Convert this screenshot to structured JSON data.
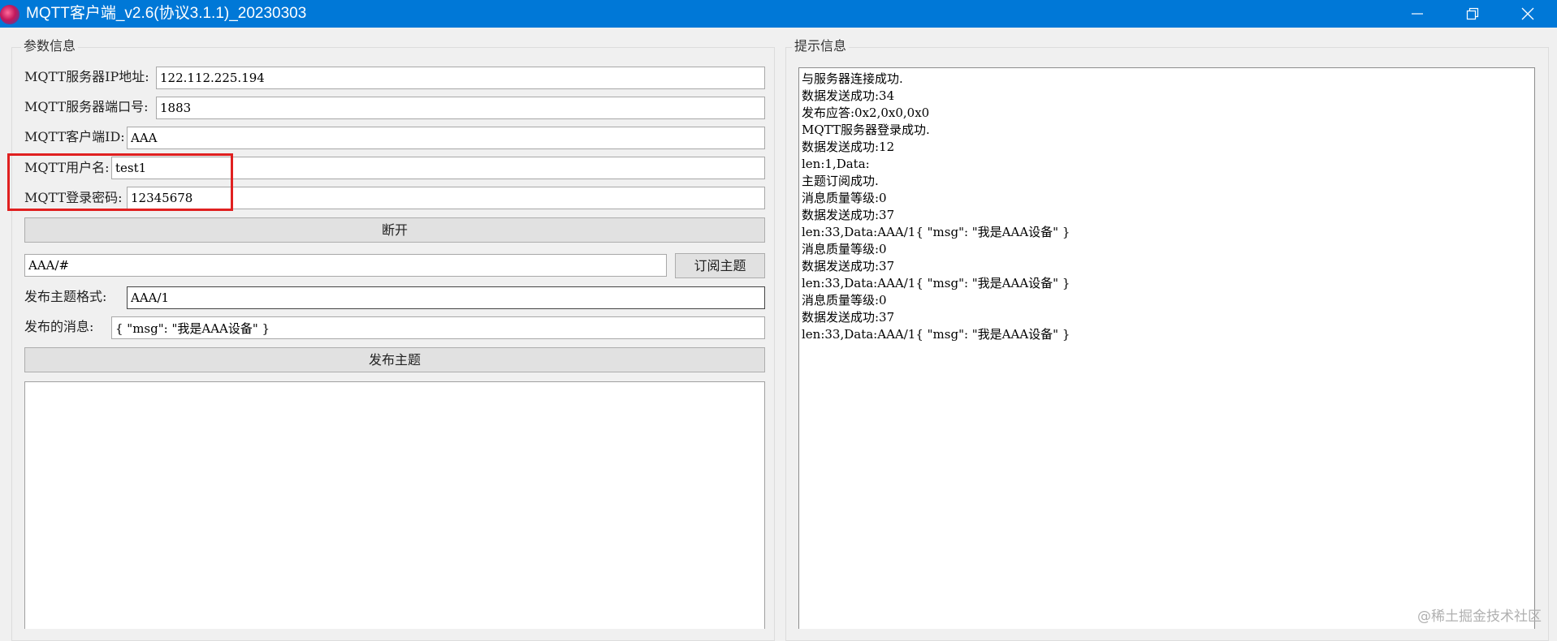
{
  "window": {
    "title": "MQTT客户端_v2.6(协议3.1.1)_20230303"
  },
  "params": {
    "group_title": "参数信息",
    "server_ip_label": "MQTT服务器IP地址:",
    "server_ip_value": "122.112.225.194",
    "server_port_label": "MQTT服务器端口号:",
    "server_port_value": "1883",
    "client_id_label": "MQTT客户端ID:",
    "client_id_value": "AAA",
    "username_label": "MQTT用户名:",
    "username_value": "test1",
    "password_label": "MQTT登录密码:",
    "password_value": "12345678",
    "disconnect_label": "断开",
    "subscribe_topic_value": "AAA/#",
    "subscribe_button_label": "订阅主题",
    "publish_topic_label": "发布主题格式:",
    "publish_topic_value": "AAA/1",
    "publish_message_label": "发布的消息:",
    "publish_message_value": "{ \"msg\": \"我是AAA设备\" }",
    "publish_button_label": "发布主题"
  },
  "log": {
    "group_title": "提示信息",
    "lines": [
      "与服务器连接成功.",
      "数据发送成功:34",
      "发布应答:0x2,0x0,0x0",
      "MQTT服务器登录成功.",
      "数据发送成功:12",
      "len:1,Data:",
      "主题订阅成功.",
      "消息质量等级:0",
      "数据发送成功:37",
      "len:33,Data:AAA/1{ \"msg\": \"我是AAA设备\" }",
      "消息质量等级:0",
      "数据发送成功:37",
      "len:33,Data:AAA/1{ \"msg\": \"我是AAA设备\" }",
      "消息质量等级:0",
      "数据发送成功:37",
      "len:33,Data:AAA/1{ \"msg\": \"我是AAA设备\" }"
    ]
  },
  "watermark": "@稀土掘金技术社区",
  "colors": {
    "titlebar": "#0078d7",
    "highlight": "#e02020"
  }
}
